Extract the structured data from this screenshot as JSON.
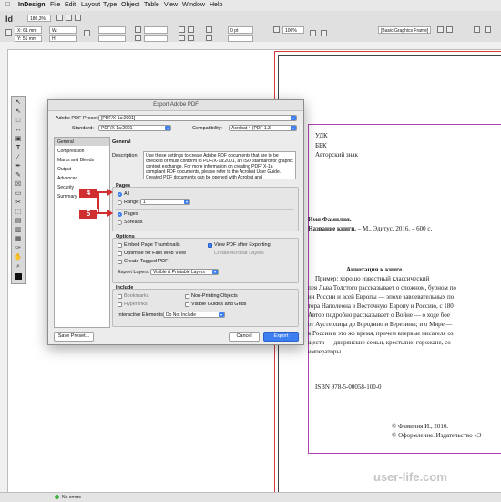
{
  "menubar": {
    "apple": "",
    "items": [
      "InDesign",
      "File",
      "Edit",
      "Layout",
      "Type",
      "Object",
      "Table",
      "View",
      "Window",
      "Help"
    ]
  },
  "control": {
    "zoom": "180,3%",
    "x": "X: 61 mm",
    "y": "Y: 51 mm",
    "w": "W:",
    "h": "H:",
    "stroke_weight": "0 pt",
    "percent": "100%",
    "frame_style": "[Basic Graphics Frame]"
  },
  "dialog": {
    "title": "Export Adobe PDF",
    "preset_label": "Adobe PDF Preset:",
    "preset_value": "[PDF/X-1a:2001]",
    "standard_label": "Standard:",
    "standard_value": "PDF/X-1a:2001",
    "compat_label": "Compatibility:",
    "compat_value": "Acrobat 4 (PDF 1.3)",
    "nav": [
      "General",
      "Compression",
      "Marks and Bleeds",
      "Output",
      "Advanced",
      "Security",
      "Summary"
    ],
    "section_title": "General",
    "desc_label": "Description:",
    "description": "Use these settings to create Adobe PDF documents that are to be checked or must conform to PDF/X-1a:2001, an ISO standard for graphic content exchange. For more information on creating PDF/ X-1a compliant PDF documents, please refer to the Acrobat User Guide. Created PDF documents can be opened with Acrobat and",
    "pages_legend": "Pages",
    "all_label": "All",
    "range_label": "Range:",
    "range_value": "1",
    "pages_label": "Pages",
    "spreads_label": "Spreads",
    "options_legend": "Options",
    "embed_thumbs": "Embed Page Thumbnails",
    "view_after": "View PDF after Exporting",
    "optimise": "Optimise for Fast Web View",
    "create_acrobat": "Create Acrobat Layers",
    "tagged": "Create Tagged PDF",
    "export_layers_label": "Export Layers:",
    "export_layers_value": "Visible & Printable Layers",
    "include_legend": "Include",
    "bookmarks": "Bookmarks",
    "non_printing": "Non-Printing Objects",
    "hyperlinks": "Hyperlinks",
    "visible_guides": "Visible Guides and Grids",
    "interactive_label": "Interactive Elements:",
    "interactive_value": "Do Not Include",
    "save_preset": "Save Preset...",
    "cancel": "Cancel",
    "export": "Export",
    "badge_4": "4",
    "badge_5": "5"
  },
  "page": {
    "udk": "УДК",
    "bbk": "ББК",
    "author_mark": "Авторский знак",
    "author_name": "Имя Фамилия.",
    "book_title_bold": "Название книги.",
    "book_title_rest": " – М., Эдитус, 2016. – 600 с.",
    "annotation_title": "Аннотация к книге.",
    "lines": [
      "Пример: хорошо известный классический",
      "пея Льва Толстого рассказывает о сложном, бурном по",
      "ии России и всей Европы — эпохе завоевательных по",
      "тора Наполеона в Восточную Европу и Россию, с 180",
      "Автор подробно рассказывает о Войне — о ходе бое",
      "от Аустерлица до Бородино и Березины; и о Мире —",
      "в России в это же время, причем впервые писателя оз",
      "ществ — дворянские семьи, крестьяне, горожане, со",
      "императоры."
    ],
    "isbn": "ISBN 978-5-00058-100-0",
    "copyright1": "© Фамилия И., 2016.",
    "copyright2": "© Оформление. Издательство «Э"
  },
  "status": {
    "errors": "No errors"
  },
  "watermark": "user-life.com"
}
